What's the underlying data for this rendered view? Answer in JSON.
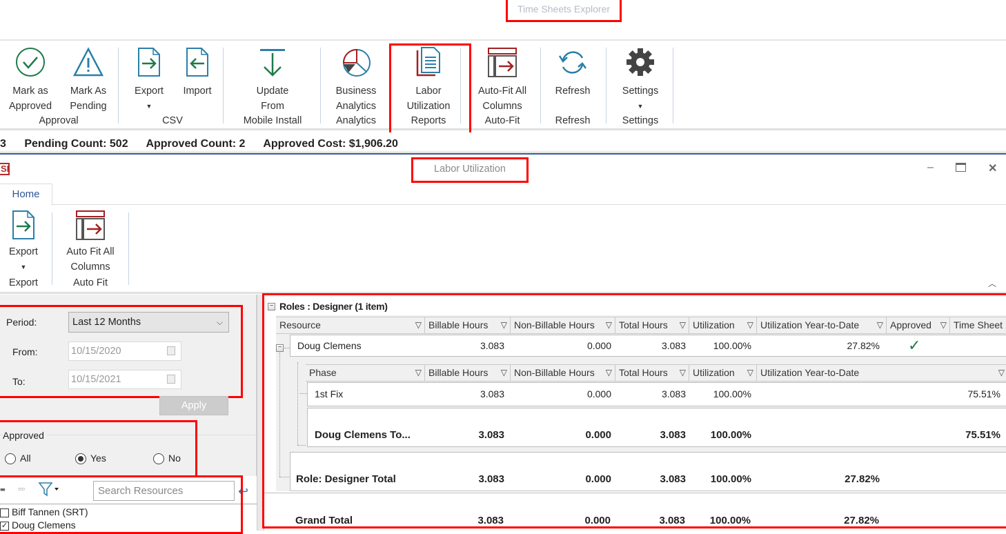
{
  "main_window": {
    "title": "Time Sheets Explorer",
    "ribbon": {
      "buttons": [
        {
          "label": "Mark as\nApproved",
          "line1": "Mark as",
          "line2": "Approved",
          "icon": "check-circle-icon"
        },
        {
          "label": "Mark As\nPending",
          "line1": "Mark As",
          "line2": "Pending",
          "icon": "warning-triangle-icon"
        },
        {
          "label": "Export",
          "line1": "Export",
          "icon": "export-file-icon"
        },
        {
          "label": "Import",
          "line1": "Import",
          "icon": "import-file-icon"
        },
        {
          "label": "Update From",
          "line1": "Update",
          "line2": "From",
          "icon": "download-arrow-icon"
        },
        {
          "label": "Business Analytics",
          "line1": "Business",
          "line2": "Analytics",
          "icon": "pie-chart-icon"
        },
        {
          "label": "Labor Utilization",
          "line1": "Labor",
          "line2": "Utilization",
          "icon": "report-document-icon"
        },
        {
          "label": "Auto-Fit All Columns",
          "line1": "Auto-Fit All",
          "line2": "Columns",
          "icon": "autofit-columns-icon"
        },
        {
          "label": "Refresh",
          "line1": "Refresh",
          "icon": "refresh-icon"
        },
        {
          "label": "Settings",
          "line1": "Settings",
          "icon": "gear-icon"
        }
      ],
      "groups": [
        "Approval",
        "CSV",
        "Mobile Install",
        "Analytics",
        "Reports",
        "Auto-Fit",
        "Refresh",
        "Settings"
      ]
    },
    "status": {
      "prefix": "3",
      "pending": "Pending Count: 502",
      "approved": "Approved Count: 2",
      "cost": "Approved Cost: $1,906.20"
    }
  },
  "report_window": {
    "logo": "SI",
    "title": "Labor Utilization",
    "controls": {
      "minimize": "–",
      "maximize": "☐",
      "close": "✕"
    },
    "tabs": [
      {
        "label": "Home"
      }
    ],
    "ribbon": {
      "export_label": "Export",
      "autofit_line1": "Auto Fit All",
      "autofit_line2": "Columns",
      "groups": [
        "Export",
        "Auto Fit"
      ]
    },
    "filters": {
      "period_label": "Period:",
      "period_value": "Last 12 Months",
      "from_label": "From:",
      "from_value": "10/15/2020",
      "to_label": "To:",
      "to_value": "10/15/2021",
      "apply_label": "Apply",
      "approved_legend": "Approved",
      "approved_options": [
        {
          "label": "All",
          "selected": false
        },
        {
          "label": "Yes",
          "selected": true
        },
        {
          "label": "No",
          "selected": false
        }
      ],
      "search_placeholder": "Search Resources",
      "resources": [
        {
          "name": "Biff Tannen (SRT)",
          "checked": false
        },
        {
          "name": "Doug Clemens",
          "checked": true
        }
      ]
    },
    "grid": {
      "group_header": "Roles : Designer (1 item)",
      "resource_columns": [
        "Resource",
        "Billable Hours",
        "Non-Billable Hours",
        "Total Hours",
        "Utilization",
        "Utilization Year-to-Date",
        "Approved",
        "Time Sheet"
      ],
      "resource_row": {
        "resource": "Doug Clemens",
        "billable": "3.083",
        "non_billable": "0.000",
        "total": "3.083",
        "utilization": "100.00%",
        "ytd": "27.82%",
        "approved": "✓"
      },
      "phase_columns": [
        "Phase",
        "Billable Hours",
        "Non-Billable Hours",
        "Total Hours",
        "Utilization",
        "Utilization Year-to-Date"
      ],
      "phase_row": {
        "phase": "1st Fix",
        "billable": "3.083",
        "non_billable": "0.000",
        "total": "3.083",
        "utilization": "100.00%",
        "ytd": "75.51%"
      },
      "resource_total": {
        "label": "Doug Clemens To...",
        "billable": "3.083",
        "non_billable": "0.000",
        "total": "3.083",
        "utilization": "100.00%",
        "ytd": "75.51%"
      },
      "role_total": {
        "label": "Role: Designer Total",
        "billable": "3.083",
        "non_billable": "0.000",
        "total": "3.083",
        "utilization": "100.00%",
        "ytd": "27.82%"
      },
      "grand_total": {
        "label": "Grand Total",
        "billable": "3.083",
        "non_billable": "0.000",
        "total": "3.083",
        "utilization": "100.00%",
        "ytd": "27.82%"
      }
    }
  },
  "colors": {
    "highlight": "#ff0000",
    "accent_green": "#1e7a4a",
    "accent_blue": "#2a7fa8",
    "accent_red": "#a32020"
  }
}
